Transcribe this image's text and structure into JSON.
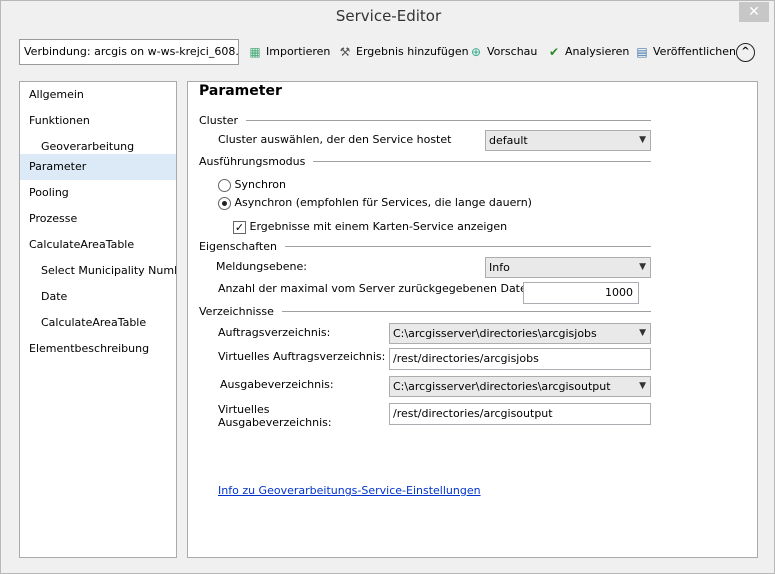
{
  "window": {
    "title": "Service-Editor",
    "close": "✕"
  },
  "toolbar": {
    "connection": "Verbindung: arcgis on w-ws-krejci_608...",
    "buttons": [
      {
        "label": "Importieren",
        "icon": "import-icon"
      },
      {
        "label": "Ergebnis hinzufügen",
        "icon": "hammer-icon"
      },
      {
        "label": "Vorschau",
        "icon": "preview-icon"
      },
      {
        "label": "Analysieren",
        "icon": "checkmark-icon"
      },
      {
        "label": "Veröffentlichen",
        "icon": "publish-icon"
      }
    ],
    "collapse": "^"
  },
  "sidebar": {
    "items": [
      {
        "label": "Allgemein"
      },
      {
        "label": "Funktionen"
      },
      {
        "label": "Geoverarbeitung"
      },
      {
        "label": "Parameter"
      },
      {
        "label": "Pooling"
      },
      {
        "label": "Prozesse"
      },
      {
        "label": "CalculateAreaTable"
      },
      {
        "label": "Select Municipality Number"
      },
      {
        "label": "Date"
      },
      {
        "label": "CalculateAreaTable"
      },
      {
        "label": "Elementbeschreibung"
      }
    ],
    "selected": "Parameter"
  },
  "main": {
    "title": "Parameter",
    "cluster": {
      "heading": "Cluster",
      "label": "Cluster auswählen, der den Service hostet",
      "value": "default"
    },
    "mode": {
      "heading": "Ausführungsmodus",
      "sync": "Synchron",
      "async": "Asynchron (empfohlen für Services, die lange dauern)",
      "selected": "async",
      "map_result": "Ergebnisse mit einem Karten-Service anzeigen",
      "map_result_checked": true
    },
    "props": {
      "heading": "Eigenschaften",
      "level_label": "Meldungsebene:",
      "level_value": "Info",
      "max_label": "Anzahl der maximal vom Server zurückgegebenen Datensätze",
      "max_value": "1000"
    },
    "dirs": {
      "heading": "Verzeichnisse",
      "jobs_label": "Auftragsverzeichnis:",
      "jobs_value": "C:\\arcgisserver\\directories\\arcgisjobs",
      "vjobs_label": "Virtuelles Auftragsverzeichnis:",
      "vjobs_value": "/rest/directories/arcgisjobs",
      "out_label": "Ausgabeverzeichnis:",
      "out_value": "C:\\arcgisserver\\directories\\arcgisoutput",
      "vout_label1": "Virtuelles",
      "vout_label2": "Ausgabeverzeichnis:",
      "vout_value": "/rest/directories/arcgisoutput"
    },
    "link": "Info zu Geoverarbeitungs-Service-Einstellungen"
  }
}
